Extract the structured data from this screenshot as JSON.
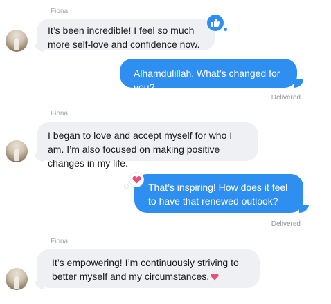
{
  "messages": [
    {
      "sender": "Fiona",
      "text": "It’s been incredible! I feel so much more self-love and confidence now.",
      "reaction": "thumbs-up"
    },
    {
      "text": "Alhamdulillah. What’s changed for you?",
      "status": "Delivered"
    },
    {
      "sender": "Fiona",
      "text": "I began to love and accept myself for who I am. I’m also focused on making positive changes in my life."
    },
    {
      "text": "That’s inspiring! How does it feel to have that renewed outlook?",
      "reaction": "heart",
      "status": "Delivered"
    },
    {
      "sender": "Fiona",
      "text": "It’s empowering! I’m continuously striving to better myself and my circumstances.",
      "emoji": "heart"
    }
  ],
  "colors": {
    "outgoing": "#2f8ff0",
    "incoming": "#eef0f3",
    "heart": "#e8507a"
  }
}
